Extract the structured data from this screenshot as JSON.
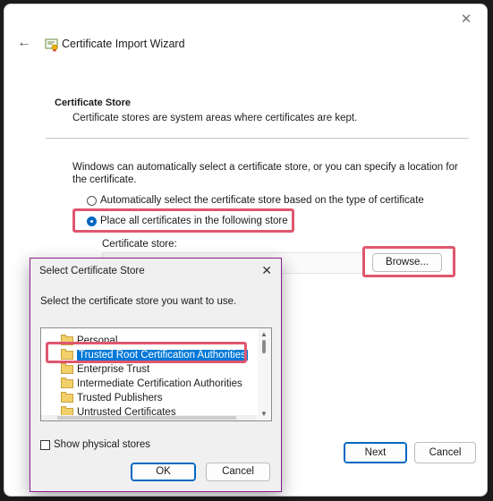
{
  "wizard": {
    "title": "Certificate Import Wizard",
    "section_title": "Certificate Store",
    "section_desc": "Certificate stores are system areas where certificates are kept.",
    "intro": "Windows can automatically select a certificate store, or you can specify a location for the certificate.",
    "radio_auto": "Automatically select the certificate store based on the type of certificate",
    "radio_place": "Place all certificates in the following store",
    "store_label": "Certificate store:",
    "store_value": "",
    "browse_label": "Browse...",
    "next_label": "Next",
    "cancel_label": "Cancel"
  },
  "dialog": {
    "title": "Select Certificate Store",
    "close_glyph": "✕",
    "prompt": "Select the certificate store you want to use.",
    "tree_items": [
      {
        "label": "Personal",
        "selected": false
      },
      {
        "label": "Trusted Root Certification Authorities",
        "selected": true
      },
      {
        "label": "Enterprise Trust",
        "selected": false
      },
      {
        "label": "Intermediate Certification Authorities",
        "selected": false
      },
      {
        "label": "Trusted Publishers",
        "selected": false
      },
      {
        "label": "Untrusted Certificates",
        "selected": false
      }
    ],
    "show_physical_label": "Show physical stores",
    "show_physical_checked": false,
    "ok_label": "OK",
    "cancel_label": "Cancel"
  },
  "colors": {
    "accent": "#0067c0",
    "highlight": "#e0566e",
    "dialog_border": "#8a1c8f",
    "selection": "#0078d7"
  },
  "icons": {
    "close": "close-icon",
    "back": "back-arrow-icon",
    "wizard": "certificate-icon",
    "folder": "folder-icon"
  }
}
